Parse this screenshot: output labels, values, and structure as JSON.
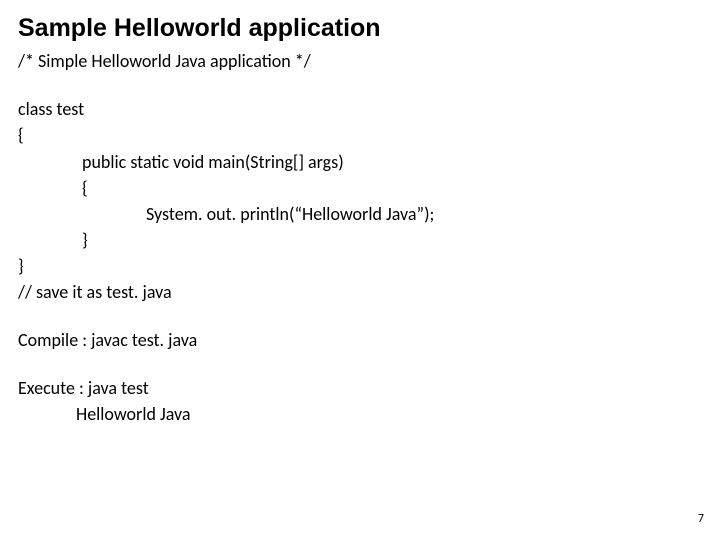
{
  "title": "Sample Helloworld application",
  "subtitle": "/* Simple Helloworld Java application */",
  "code": {
    "line1": "class test",
    "line2": "{",
    "line3": "public static void main(String[] args)",
    "line4": "{",
    "line5": "System. out. println(“Helloworld Java”);",
    "line6": "}",
    "line7": "}",
    "line8": "// save it as test. java"
  },
  "compile": "Compile : javac test. java",
  "execute": {
    "cmd": "Execute : java test",
    "output": "Helloworld Java"
  },
  "page_number": "7"
}
